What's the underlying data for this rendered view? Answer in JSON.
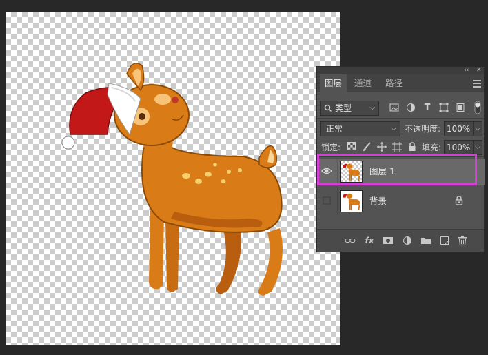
{
  "panel": {
    "collapse_glyph": "‹‹",
    "close_glyph": "✕",
    "tabs": [
      {
        "label": "图层",
        "active": true
      },
      {
        "label": "通道",
        "active": false
      },
      {
        "label": "路径",
        "active": false
      }
    ],
    "filter": {
      "value": "类型",
      "icons": [
        "image-filter-icon",
        "adjustment-filter-icon",
        "type-filter-icon",
        "shape-filter-icon",
        "smart-object-filter-icon",
        "filter-toggle-icon"
      ]
    },
    "blend_mode": "正常",
    "opacity_label": "不透明度:",
    "opacity_value": "100%",
    "lock_label": "锁定:",
    "fill_label": "填充:",
    "fill_value": "100%",
    "layers": [
      {
        "name": "图层 1",
        "visible": true,
        "selected": true,
        "locked": false
      },
      {
        "name": "背景",
        "visible": false,
        "selected": false,
        "locked": true
      }
    ],
    "footer_icons": [
      "link-layers-icon",
      "fx-icon",
      "add-mask-icon",
      "adjustment-layer-icon",
      "new-group-icon",
      "new-layer-icon",
      "delete-layer-icon"
    ],
    "fx_label": "fx"
  },
  "colors": {
    "selection": "#d53fd8",
    "panel": "#535353",
    "background": "#282828"
  }
}
